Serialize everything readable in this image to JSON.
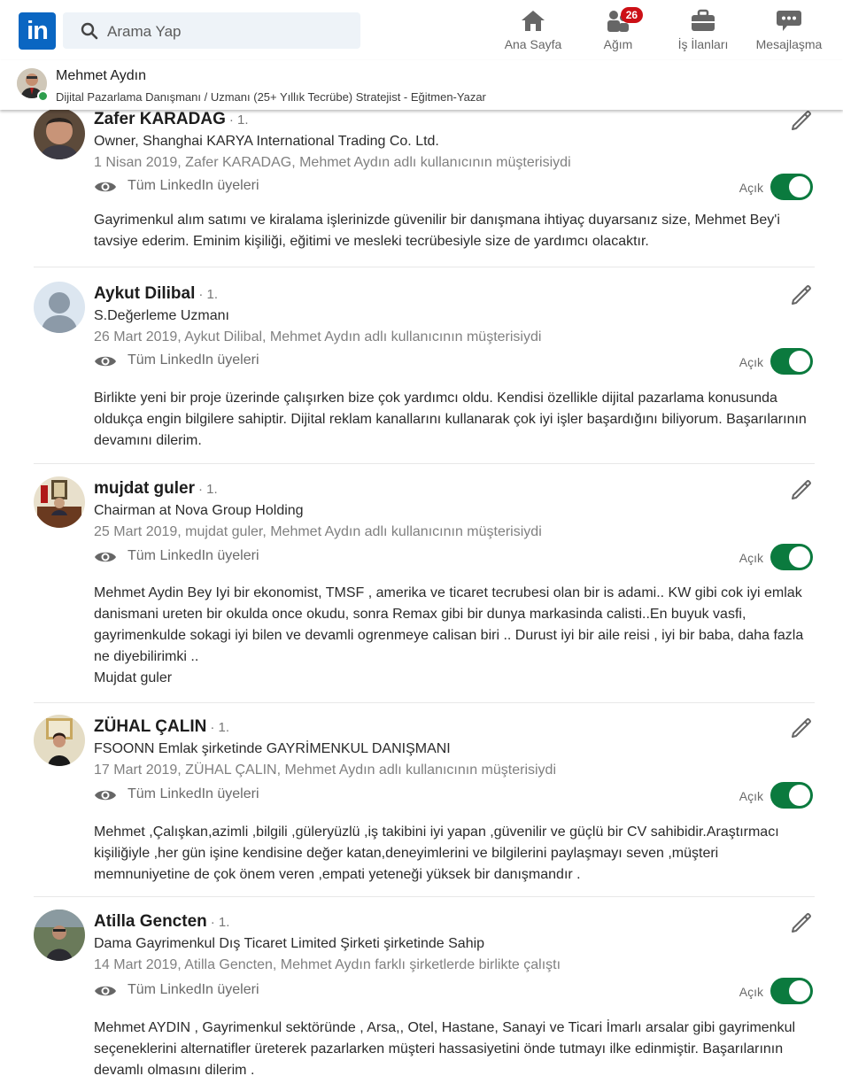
{
  "nav": {
    "logo_text": "in",
    "search_placeholder": "Arama Yap",
    "items": [
      {
        "label": "Ana Sayfa",
        "icon": "home-icon"
      },
      {
        "label": "Ağım",
        "icon": "network-icon",
        "badge": "26"
      },
      {
        "label": "İş İlanları",
        "icon": "briefcase-icon"
      },
      {
        "label": "Mesajlaşma",
        "icon": "messaging-icon"
      }
    ]
  },
  "profile": {
    "name": "Mehmet Aydın",
    "headline": "Dijital Pazarlama Danışmanı / Uzmanı (25+ Yıllık Tecrübe) Stratejist - Eğitmen-Yazar",
    "online_color": "#2e9e4d"
  },
  "colors": {
    "brand": "#0a66c2",
    "toggle_on": "#0b7a3e",
    "badge": "#cc1016"
  },
  "recommendations": [
    {
      "name": "Zafer KARADAG",
      "degree": "· 1.",
      "title": "Owner, Shanghai KARYA International Trading Co. Ltd.",
      "date_line": "1 Nisan 2019, Zafer KARADAG, Mehmet Aydın adlı kullanıcının müşterisiydi",
      "visibility": "Tüm LinkedIn üyeleri",
      "toggle_label": "Açık",
      "text": "Gayrimenkul alım satımı ve kiralama işlerinizde güvenilir bir danışmana ihtiyaç duyarsanız size, Mehmet Bey'i tavsiye ederim. Eminim kişiliği, eğitimi ve mesleki tecrübesiyle size de yardımcı olacaktır."
    },
    {
      "name": "Aykut Dilibal",
      "degree": "· 1.",
      "title": "S.Değerleme Uzmanı",
      "date_line": "26 Mart 2019, Aykut Dilibal, Mehmet Aydın adlı kullanıcının müşterisiydi",
      "visibility": "Tüm LinkedIn üyeleri",
      "toggle_label": "Açık",
      "text": "Birlikte yeni bir proje üzerinde çalışırken bize çok yardımcı oldu. Kendisi özellikle dijital pazarlama konusunda oldukça engin bilgilere sahiptir. Dijital reklam kanallarını kullanarak çok iyi işler başardığını biliyorum. Başarılarının devamını dilerim."
    },
    {
      "name": "mujdat guler",
      "degree": "· 1.",
      "title": "Chairman at Nova Group Holding",
      "date_line": "25 Mart 2019, mujdat guler, Mehmet Aydın adlı kullanıcının müşterisiydi",
      "visibility": "Tüm LinkedIn üyeleri",
      "toggle_label": "Açık",
      "text": "Mehmet Aydin Bey Iyi bir ekonomist, TMSF , amerika ve ticaret tecrubesi olan bir is adami.. KW gibi cok iyi emlak danismani ureten bir okulda once okudu, sonra Remax gibi bir dunya markasinda calisti..En buyuk vasfi, gayrimenkulde sokagi iyi bilen ve devamli ogrenmeye calisan biri .. Durust iyi bir aile reisi , iyi bir baba, daha fazla ne diyebilirimki ..\nMujdat guler"
    },
    {
      "name": "ZÜHAL ÇALIN",
      "degree": "· 1.",
      "title": "FSOONN Emlak şirketinde GAYRİMENKUL DANIŞMANI",
      "date_line": "17 Mart 2019, ZÜHAL ÇALIN, Mehmet Aydın adlı kullanıcının müşterisiydi",
      "visibility": "Tüm LinkedIn üyeleri",
      "toggle_label": "Açık",
      "text": "Mehmet ,Çalışkan,azimli ,bilgili ,güleryüzlü ,iş takibini iyi yapan ,güvenilir ve güçlü bir CV sahibidir.Araştırmacı kişiliğiyle ,her gün işine kendisine değer katan,deneyimlerini ve bilgilerini paylaşmayı seven ,müşteri memnuniyetine de çok önem veren ,empati yeteneği yüksek bir danışmandır ."
    },
    {
      "name": "Atilla Gencten",
      "degree": "· 1.",
      "title": "Dama Gayrimenkul Dış Ticaret Limited Şirketi şirketinde Sahip",
      "date_line": "14 Mart 2019, Atilla Gencten, Mehmet Aydın farklı şirketlerde birlikte çalıştı",
      "visibility": "Tüm LinkedIn üyeleri",
      "toggle_label": "Açık",
      "text": "Mehmet AYDIN , Gayrimenkul sektöründe , Arsa,, Otel, Hastane, Sanayi ve Ticari İmarlı arsalar gibi gayrimenkul seçeneklerini alternatifler üreterek pazarlarken müşteri hassasiyetini önde tutmayı ilke edinmiştir. Başarılarının devamlı olmasını dilerim ."
    }
  ]
}
